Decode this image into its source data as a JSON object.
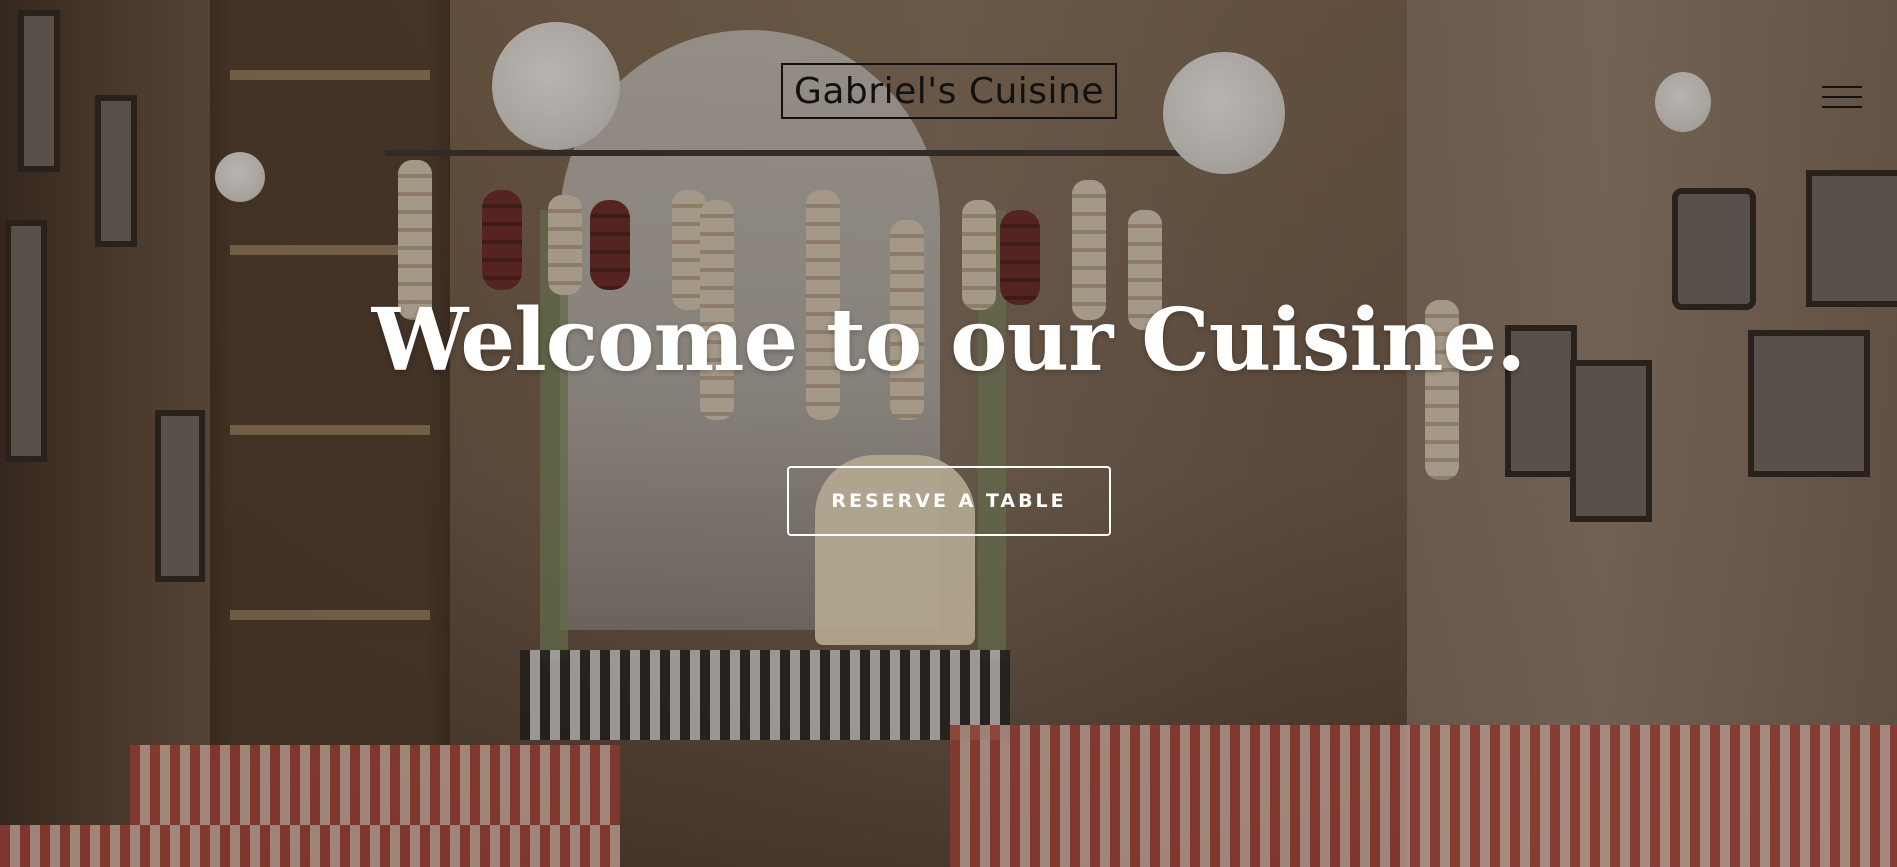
{
  "header": {
    "brand": "Gabriel's Cuisine",
    "menu_icon": "hamburger-menu-icon"
  },
  "hero": {
    "headline": "Welcome to our Cuisine.",
    "cta_label": "RESERVE A TABLE"
  },
  "colors": {
    "text_light": "#ffffff",
    "text_dark": "#111111"
  }
}
